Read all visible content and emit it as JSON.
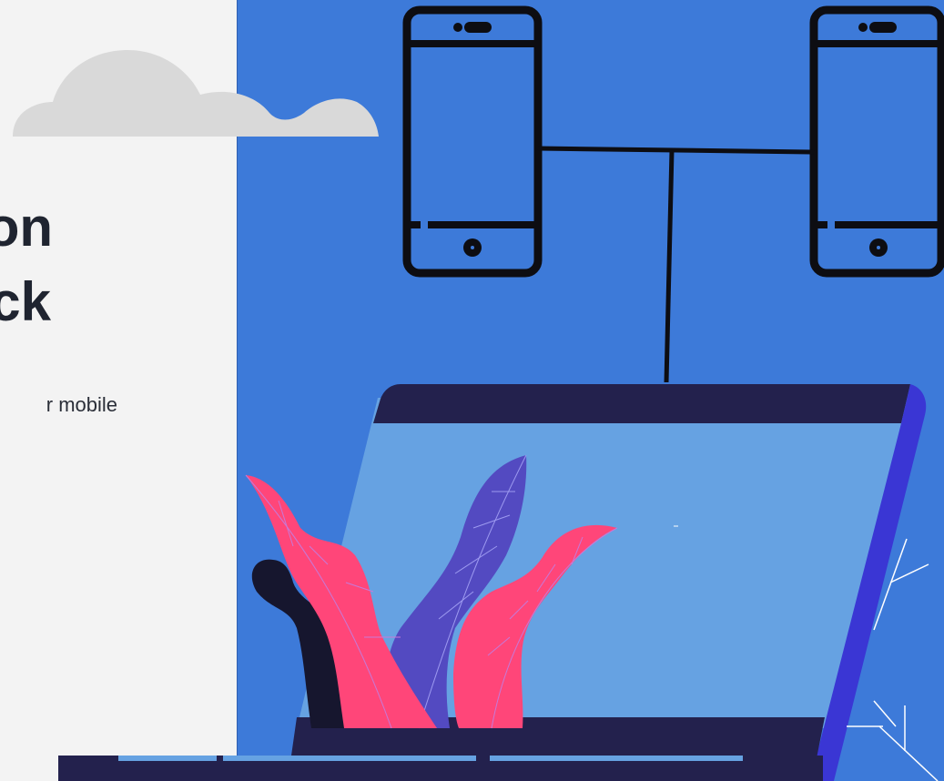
{
  "hero": {
    "heading_line1": "on",
    "heading_line2": "ck",
    "subtext": "r mobile"
  },
  "colors": {
    "panel_left": "#f3f3f3",
    "panel_right": "#3d7ad9",
    "laptop_frame": "#23214d",
    "laptop_screen": "#66a2e2",
    "laptop_edge": "#3a36d4",
    "leaf_pink": "#ff4679",
    "leaf_purple": "#534ac1",
    "blob_dark": "#16162e",
    "cloud": "#d9d9d9"
  }
}
